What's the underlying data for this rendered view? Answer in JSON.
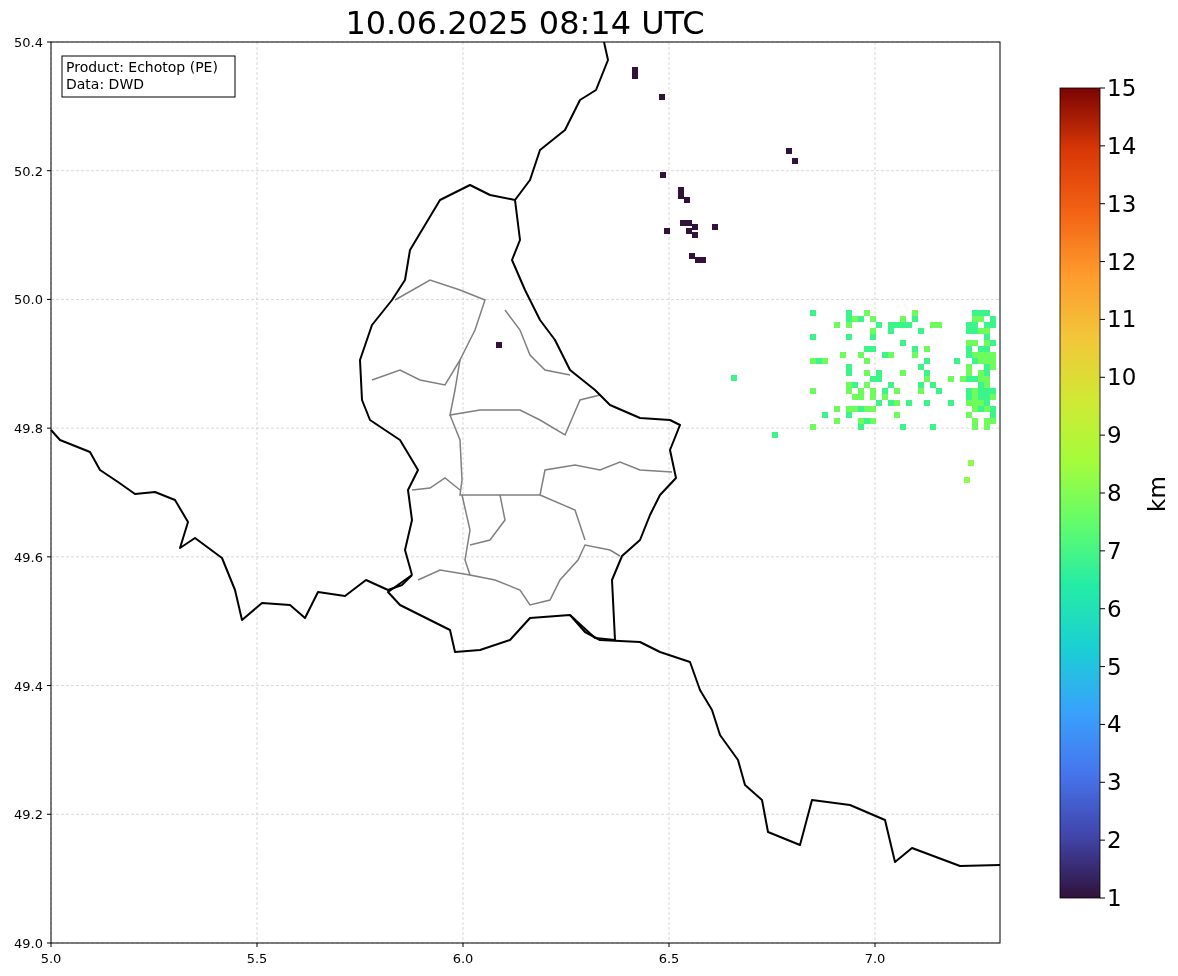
{
  "title": "10.06.2025 08:14 UTC",
  "info": [
    "Product: Echotop (PE)",
    "Data: DWD"
  ],
  "xticks": [
    "5.0",
    "5.5",
    "6.0",
    "6.5",
    "7.0"
  ],
  "yticks": [
    "50.4",
    "50.2",
    "50.0",
    "49.8",
    "49.6",
    "49.4",
    "49.2",
    "49.0"
  ],
  "colorbar": {
    "ticks": [
      "15",
      "14",
      "13",
      "12",
      "11",
      "10",
      "9",
      "8",
      "7",
      "6",
      "5",
      "4",
      "3",
      "2",
      "1"
    ],
    "label": "km"
  }
}
